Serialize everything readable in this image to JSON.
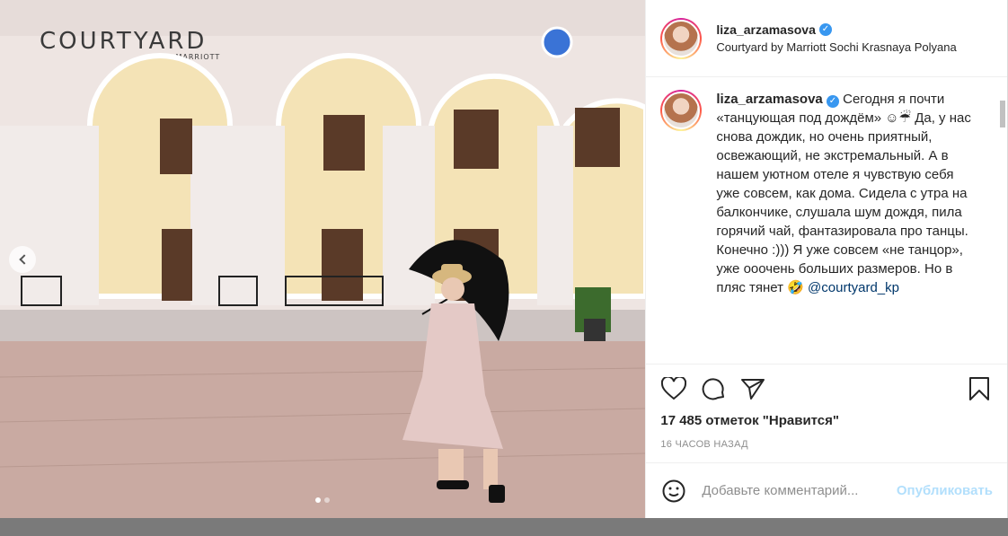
{
  "post": {
    "photo": {
      "building_sign": "COURTYARD",
      "building_sign_sub": "BY MARRIOTT",
      "carousel_total": 2,
      "carousel_active": 1
    },
    "header": {
      "username": "liza_arzamasova",
      "location": "Courtyard by Marriott Sochi Krasnaya Polyana"
    },
    "caption": {
      "username": "liza_arzamasova",
      "text": "Сегодня я почти «танцующая под дождём» ☺☔ Да, у нас снова дождик, но очень приятный, освежающий, не экстремальный. А в нашем уютном отеле я чувствую себя уже совсем, как дома. Сидела с утра на балкончике, слушала шум дождя, пила горячий чай, фантазировала про танцы. Конечно :))) Я уже совсем «не танцор», уже ооочень больших размеров. Но в пляс тянет 🤣",
      "mention": "@courtyard_kp"
    },
    "likes": "17 485 отметок \"Нравится\"",
    "time": "16 ЧАСОВ НАЗАД",
    "comment": {
      "placeholder": "Добавьте комментарий...",
      "publish_label": "Опубликовать"
    },
    "colors": {
      "accent": "#3897f0",
      "publish_disabled": "#b2dffc",
      "mention": "#00376b"
    }
  }
}
